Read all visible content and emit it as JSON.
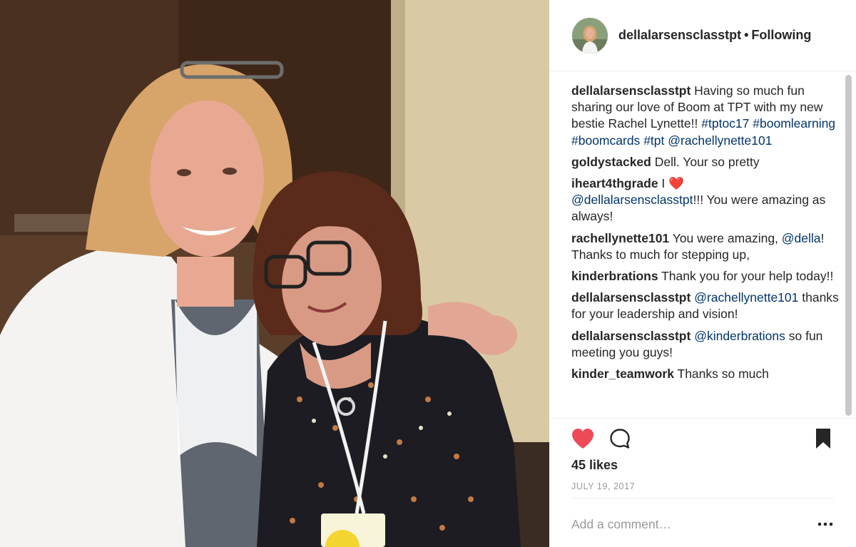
{
  "post": {
    "username": "dellalarsensclasstpt",
    "separator": "•",
    "follow_status": "Following",
    "caption": {
      "username": "dellalarsensclasstpt",
      "text": " Having so much fun sharing our love of Boom at TPT with my new bestie Rachel Lynette!! ",
      "tags": [
        "#tptoc17",
        "#boomlearning",
        "#boomcards",
        "#tpt",
        "@rachellynette101"
      ]
    },
    "comments": [
      {
        "username": "goldystacked",
        "text": " Dell. Your so pretty"
      },
      {
        "username": "iheart4thgrade",
        "text_before": " I ",
        "emoji": "❤️",
        "mention": "@dellalarsensclasstpt",
        "text_after": "!!! You were amazing as always!"
      },
      {
        "username": "rachellynette101",
        "text_before": " You were amazing, ",
        "mention": "@della",
        "text_after": "! Thanks to much for stepping up,"
      },
      {
        "username": "kinderbrations",
        "text": " Thank you for your help today!!"
      },
      {
        "username": "dellalarsensclasstpt",
        "mention": "@rachellynette101",
        "text_after": " thanks for your leadership and vision!"
      },
      {
        "username": "dellalarsensclasstpt",
        "mention": "@kinderbrations",
        "text_after": " so fun meeting you guys!"
      },
      {
        "username": "kinder_teamwork",
        "text": " Thanks so much"
      }
    ],
    "likes": "45 likes",
    "date": "JULY 19, 2017",
    "add_comment_placeholder": "Add a comment…"
  },
  "icons": {
    "like": "heart-icon",
    "comment": "comment-bubble-icon",
    "save": "bookmark-icon",
    "more": "more-options-icon"
  },
  "colors": {
    "like_red": "#ed4956",
    "link_blue": "#003569",
    "muted_gray": "#999999"
  }
}
